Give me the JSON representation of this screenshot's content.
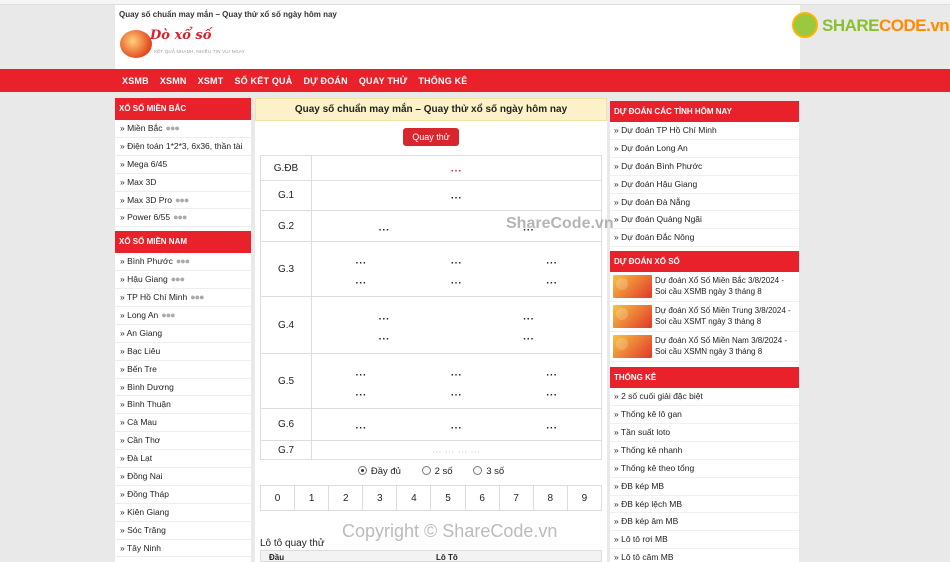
{
  "header": {
    "top_title": "Quay số chuẩn may mắn – Quay thử xổ số ngày hôm nay",
    "logo_name": "Dò xổ số",
    "logo_slogan": "KẾT QUẢ NHANH, NHIỀU TIN VUI NGAY",
    "sharecode_left": "SHARE",
    "sharecode_right": "CODE.vn"
  },
  "nav": [
    "XSMB",
    "XSMN",
    "XSMT",
    "SỐ KẾT QUẢ",
    "DỰ ĐOÁN",
    "QUAY THỬ",
    "THỐNG KÊ"
  ],
  "left": {
    "north_title": "XỔ SỐ MIỀN BẮC",
    "north_items": [
      {
        "label": "» Miền Bắc",
        "dots": "●●●"
      },
      {
        "label": "» Điện toán 1*2*3, 6x36, thần tài",
        "dots": ""
      },
      {
        "label": "» Mega 6/45",
        "dots": ""
      },
      {
        "label": "» Max 3D",
        "dots": ""
      },
      {
        "label": "» Max 3D Pro",
        "dots": "●●●"
      },
      {
        "label": "» Power 6/55",
        "dots": "●●●"
      }
    ],
    "south_title": "XỔ SỐ MIỀN NAM",
    "south_items": [
      {
        "label": "» Bình Phước",
        "dots": "●●●"
      },
      {
        "label": "» Hậu Giang",
        "dots": "●●●"
      },
      {
        "label": "» TP Hồ Chí Minh",
        "dots": "●●●"
      },
      {
        "label": "» Long An",
        "dots": "●●●"
      },
      {
        "label": "» An Giang",
        "dots": ""
      },
      {
        "label": "» Bạc Liêu",
        "dots": ""
      },
      {
        "label": "» Bến Tre",
        "dots": ""
      },
      {
        "label": "» Bình Dương",
        "dots": ""
      },
      {
        "label": "» Bình Thuận",
        "dots": ""
      },
      {
        "label": "» Cà Mau",
        "dots": ""
      },
      {
        "label": "» Cần Thơ",
        "dots": ""
      },
      {
        "label": "» Đà Lạt",
        "dots": ""
      },
      {
        "label": "» Đồng Nai",
        "dots": ""
      },
      {
        "label": "» Đồng Tháp",
        "dots": ""
      },
      {
        "label": "» Kiên Giang",
        "dots": ""
      },
      {
        "label": "» Sóc Trăng",
        "dots": ""
      },
      {
        "label": "» Tây Ninh",
        "dots": ""
      }
    ]
  },
  "center": {
    "title": "Quay số chuẩn may mắn – Quay thử xổ số ngày hôm nay",
    "spin_button": "Quay thử",
    "prizes": [
      "G.ĐB",
      "G.1",
      "G.2",
      "G.3",
      "G.4",
      "G.5",
      "G.6",
      "G.7"
    ],
    "placeholder": "...",
    "g7_placeholder": "... ... ... ...",
    "radio_options": [
      {
        "label": "Đầy đủ",
        "selected": true
      },
      {
        "label": "2 số",
        "selected": false
      },
      {
        "label": "3 số",
        "selected": false
      }
    ],
    "digits": [
      "0",
      "1",
      "2",
      "3",
      "4",
      "5",
      "6",
      "7",
      "8",
      "9"
    ],
    "loto_title": "Lô tô quay thử",
    "loto_col1": "Đầu",
    "loto_col2": "Lô Tô"
  },
  "right": {
    "predict_title": "DỰ ĐOÁN CÁC TỈNH HÔM NAY",
    "predict_items": [
      "» Dự đoán TP Hồ Chí Minh",
      "» Dự đoán Long An",
      "» Dự đoán Bình Phước",
      "» Dự đoán Hậu Giang",
      "» Dự đoán Đà Nẵng",
      "» Dự đoán Quảng Ngãi",
      "» Dự đoán Đắc Nông"
    ],
    "lottery_title": "DỰ ĐOÁN XỔ SỐ",
    "news": [
      {
        "line1": "Dự đoán Xổ Số Miền Bắc 3/8/2024 -",
        "line2": "Soi cầu XSMB ngày 3 tháng 8"
      },
      {
        "line1": "Dự đoán Xổ Số Miền Trung 3/8/2024 -",
        "line2": "Soi cầu XSMT ngày 3 tháng 8"
      },
      {
        "line1": "Dự đoán Xổ Số Miền Nam 3/8/2024 -",
        "line2": "Soi cầu XSMN ngày 3 tháng 8"
      }
    ],
    "stats_title": "THỐNG KÊ",
    "stats_items": [
      "» 2 số cuối giải đặc biệt",
      "» Thống kê lô gan",
      "» Tần suất loto",
      "» Thống kê nhanh",
      "» Thống kê theo tổng",
      "» ĐB kép MB",
      "» ĐB kép lệch MB",
      "» ĐB kép âm MB",
      "» Lô tô rơi MB",
      "» Lô tô câm MB"
    ]
  },
  "watermarks": {
    "mid": "ShareCode.vn",
    "bottom": "Copyright © ShareCode.vn"
  },
  "colors": {
    "brand_red": "#e8212b",
    "header_yellow": "#fcf1c8"
  }
}
